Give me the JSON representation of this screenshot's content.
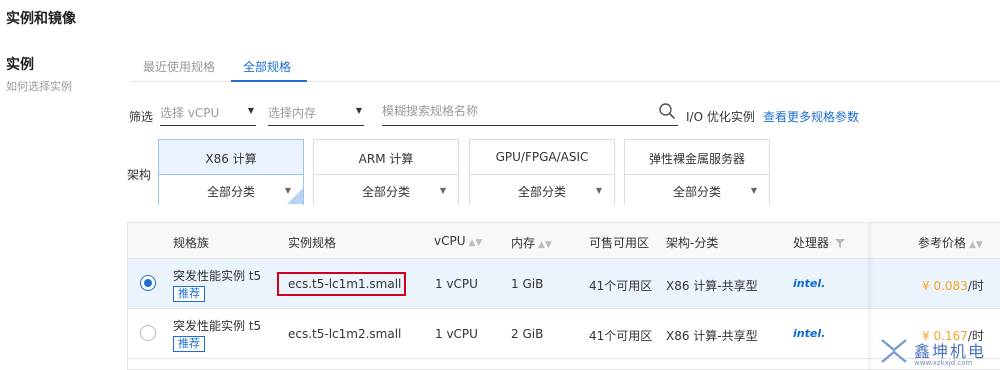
{
  "section": {
    "title": "实例和镜像"
  },
  "side": {
    "title": "实例",
    "subtitle": "如何选择实例"
  },
  "tabs": [
    {
      "label": "最近使用规格",
      "active": false
    },
    {
      "label": "全部规格",
      "active": true
    }
  ],
  "filter": {
    "label": "筛选",
    "vcpu_placeholder": "选择 vCPU",
    "memory_placeholder": "选择内存",
    "search_placeholder": "模糊搜索规格名称",
    "io_label": "I/O 优化实例",
    "more_link": "查看更多规格参数"
  },
  "architecture": {
    "label": "架构",
    "cards": [
      {
        "title": "X86 计算",
        "dropdown": "全部分类",
        "active": true
      },
      {
        "title": "ARM 计算",
        "dropdown": "全部分类",
        "active": false
      },
      {
        "title": "GPU/FPGA/ASIC",
        "dropdown": "全部分类",
        "active": false
      },
      {
        "title": "弹性裸金属服务器",
        "dropdown": "全部分类",
        "active": false
      }
    ]
  },
  "table": {
    "headers": {
      "family": "规格族",
      "spec": "实例规格",
      "vcpu": "vCPU",
      "memory": "内存",
      "zones": "可售可用区",
      "arch": "架构-分类",
      "cpu": "处理器",
      "price": "参考价格"
    },
    "rows": [
      {
        "selected": true,
        "family": "突发性能实例 t5",
        "badge": "推荐",
        "spec": "ecs.t5-lc1m1.small",
        "vcpu": "1 vCPU",
        "memory": "1 GiB",
        "zones": "41个可用区",
        "arch": "X86 计算-共享型",
        "cpu": "intel.",
        "price_amount": "¥ 0.083",
        "price_unit": "/时"
      },
      {
        "selected": false,
        "family": "突发性能实例 t5",
        "badge": "推荐",
        "spec": "ecs.t5-lc1m2.small",
        "vcpu": "1 vCPU",
        "memory": "2 GiB",
        "zones": "41个可用区",
        "arch": "X86 计算-共享型",
        "cpu": "intel.",
        "price_amount": "¥ 0.167",
        "price_unit": "/时"
      }
    ]
  },
  "watermark": {
    "text": "鑫坤机电",
    "url": "www.xzkxjd.com"
  },
  "colors": {
    "accent": "#1f6fd1",
    "price": "#f5a623",
    "highlight_box": "#d0021b",
    "selected_row": "#ebf3fd"
  }
}
